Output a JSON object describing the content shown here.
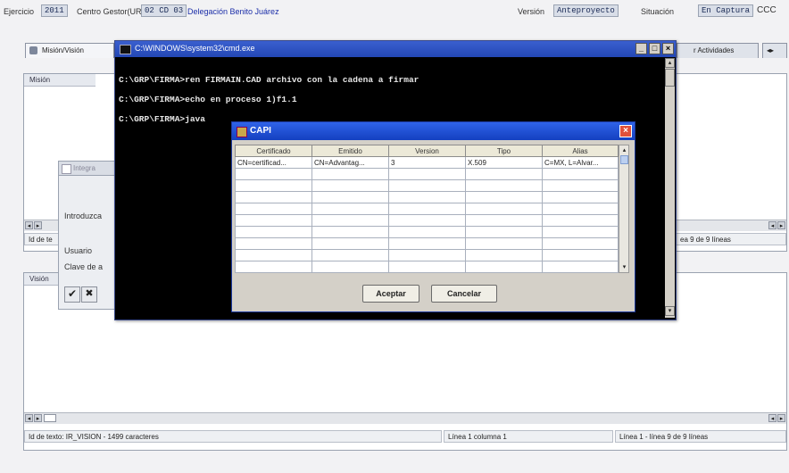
{
  "header": {
    "ejercicio_label": "Ejercicio",
    "ejercicio_value": "2011",
    "centro_label": "Centro Gestor(UR)",
    "centro_value": "02 CD 03",
    "centro_name": "Delegación Benito Juárez",
    "version_label": "Versión",
    "version_value": "Anteproyecto",
    "situacion_label": "Situación",
    "situacion_value": "En Captura",
    "situacion_extra": "CCC"
  },
  "tabs": {
    "mision": "Misión/Visión",
    "actividades": "r Actividades"
  },
  "mision_panel": {
    "title": "Misión",
    "status_left": "Id de te"
  },
  "vision_panel": {
    "title": "Visión",
    "status_left": "Id de texto: IR_VISION - 1499 caracteres",
    "status_mid": "Línea 1 columna 1",
    "status_right": "Línea 1 - línea 9 de 9 líneas"
  },
  "right_status": "ea 9 de 9 líneas",
  "login": {
    "title": "Integra",
    "introduzca": "Introduzca",
    "usuario": "Usuario",
    "clave": "Clave de a"
  },
  "cmd": {
    "title": "C:\\WINDOWS\\system32\\cmd.exe",
    "lines": [
      "C:\\GRP\\FIRMA>ren FIRMAIN.CAD archivo con la cadena a firmar",
      "C:\\GRP\\FIRMA>echo en proceso  1)f1.1",
      "C:\\GRP\\FIRMA>java"
    ]
  },
  "capi": {
    "title": "CAPI",
    "columns": [
      "Certificado",
      "Emitido",
      "Version",
      "Tipo",
      "Alias"
    ],
    "rows": [
      [
        "CN=certificad...",
        "CN=Advantag...",
        "3",
        "X.509",
        "C=MX, L=Alvar..."
      ]
    ],
    "empty_rows": 9,
    "accept": "Aceptar",
    "cancel": "Cancelar"
  }
}
